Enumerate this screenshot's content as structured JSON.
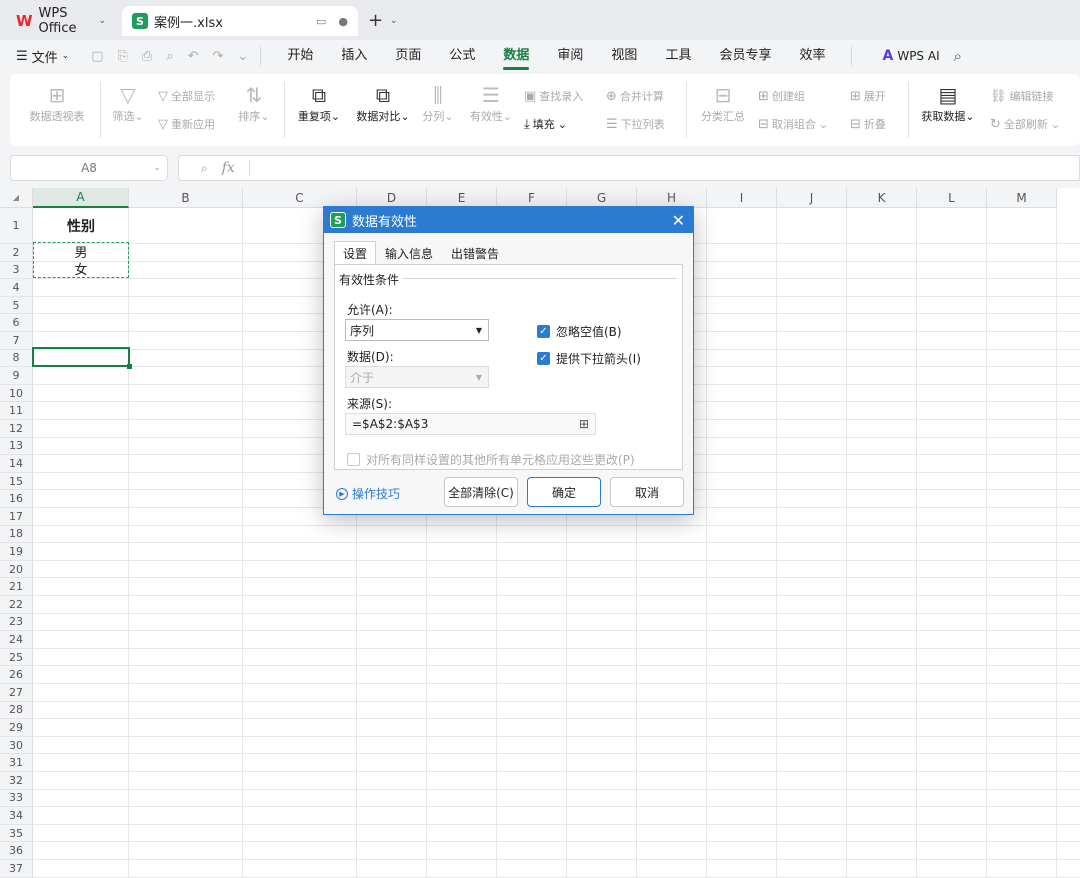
{
  "tabs": {
    "wps_label": "WPS Office",
    "file_name": "案例一.xlsx",
    "file_icon_letter": "S"
  },
  "menu": {
    "file": "文件",
    "items": [
      "开始",
      "插入",
      "页面",
      "公式",
      "数据",
      "审阅",
      "视图",
      "工具",
      "会员专享",
      "效率"
    ],
    "active": "数据",
    "wps_ai": "WPS AI"
  },
  "ribbon": {
    "pivot": "数据透视表",
    "filter": "筛选",
    "show_all": "全部显示",
    "reapply": "重新应用",
    "sort": "排序",
    "duplicates": "重复项",
    "compare": "数据对比",
    "split": "分列",
    "validity": "有效性",
    "lookup_entry": "查找录入",
    "fill": "填充",
    "merge_calc": "合并计算",
    "dropdown_list": "下拉列表",
    "subtotal": "分类汇总",
    "create_group": "创建组",
    "ungroup": "取消组合",
    "expand": "展开",
    "collapse": "折叠",
    "get_data": "获取数据",
    "edit_links": "编辑链接",
    "refresh_all": "全部刷新"
  },
  "formula_bar": {
    "cell_ref": "A8",
    "fx": "fx",
    "value": ""
  },
  "sheet": {
    "columns": [
      "A",
      "B",
      "C",
      "D",
      "E",
      "F",
      "G",
      "H",
      "I",
      "J",
      "K",
      "L",
      "M"
    ],
    "rows": [
      "1",
      "2",
      "3",
      "4",
      "5",
      "6",
      "7",
      "8",
      "9",
      "10",
      "11",
      "12",
      "13",
      "14",
      "15",
      "16",
      "17",
      "18",
      "19",
      "20",
      "21",
      "22",
      "23",
      "24",
      "25",
      "26",
      "27",
      "28",
      "29",
      "30",
      "31",
      "32",
      "33",
      "34",
      "35",
      "36",
      "37"
    ],
    "a1": "性别",
    "a2": "男",
    "a3": "女"
  },
  "dialog": {
    "title": "数据有效性",
    "icon_letter": "S",
    "close": "✕",
    "tabs": [
      "设置",
      "输入信息",
      "出错警告"
    ],
    "group_label": "有效性条件",
    "allow_label": "允许(A):",
    "allow_value": "序列",
    "data_label": "数据(D):",
    "data_value": "介于",
    "source_label": "来源(S):",
    "source_value": "=$A$2:$A$3",
    "ignore_blank": "忽略空值(B)",
    "dropdown_arrow": "提供下拉箭头(I)",
    "apply_all": "对所有同样设置的其他所有单元格应用这些更改(P)",
    "tips": "操作技巧",
    "clear_all": "全部清除(C)",
    "ok": "确定",
    "cancel": "取消"
  }
}
